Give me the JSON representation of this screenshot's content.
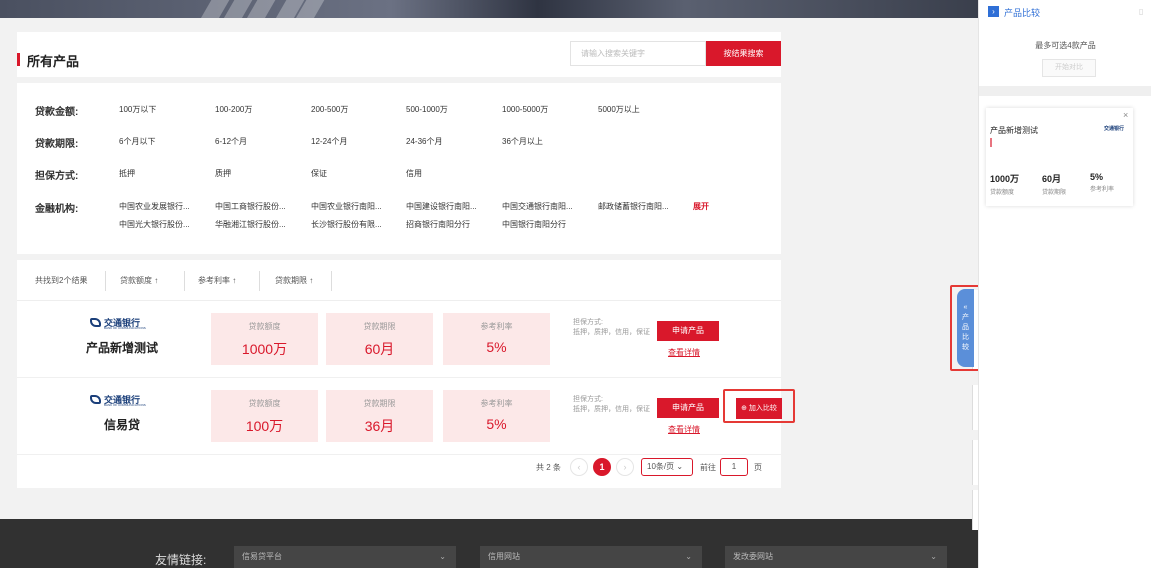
{
  "page": {
    "title": "所有产品",
    "search": {
      "placeholder": "请输入搜索关键字",
      "button": "按结果搜索"
    }
  },
  "filters": [
    {
      "label": "贷款金额:",
      "options": [
        "100万以下",
        "100-200万",
        "200-500万",
        "500-1000万",
        "1000-5000万",
        "5000万以上"
      ]
    },
    {
      "label": "贷款期限:",
      "options": [
        "6个月以下",
        "6-12个月",
        "12-24个月",
        "24-36个月",
        "36个月以上"
      ]
    },
    {
      "label": "担保方式:",
      "options": [
        "抵押",
        "质押",
        "保证",
        "信用"
      ]
    },
    {
      "label": "金融机构:",
      "options": [
        "中国农业发展银行...",
        "中国工商银行股份...",
        "中国农业银行南阳...",
        "中国建设银行南阳...",
        "中国交通银行南阳...",
        "邮政储蓄银行南阳..."
      ],
      "options2": [
        "中国光大银行股份...",
        "华融湘江银行股份...",
        "长沙银行股份有限...",
        "招商银行南阳分行",
        "中国银行南阳分行"
      ],
      "expand": "展开"
    }
  ],
  "sort": {
    "result_count": "共找到2个结果",
    "items": [
      "贷款额度 ↑",
      "参考利率 ↑",
      "贷款期限 ↑"
    ]
  },
  "products": [
    {
      "bank": "交通银行",
      "bank_en": "BANK OF COMMUNICATIONS",
      "name": "产品新增测试",
      "amount_label": "贷款额度",
      "amount": "1000万",
      "term_label": "贷款期限",
      "term": "60月",
      "rate_label": "参考利率",
      "rate": "5%",
      "guarantee_title": "担保方式:",
      "guarantee": "抵押，质押，信用，保证",
      "apply": "申请产品",
      "detail": "查看详情"
    },
    {
      "bank": "交通银行",
      "bank_en": "BANK OF COMMUNICATIONS",
      "name": "信易贷",
      "amount_label": "贷款额度",
      "amount": "100万",
      "term_label": "贷款期限",
      "term": "36月",
      "rate_label": "参考利率",
      "rate": "5%",
      "guarantee_title": "担保方式:",
      "guarantee": "抵押，质押，信用，保证",
      "apply": "申请产品",
      "detail": "查看详情",
      "compare": "⊕ 加入比较"
    }
  ],
  "pagination": {
    "total": "共 2 条",
    "prev": "‹",
    "current": "1",
    "next": "›",
    "page_size": "10条/页",
    "goto_label": "前往",
    "goto_value": "1",
    "unit": "页"
  },
  "footer": {
    "label": "友情链接:",
    "selects": [
      "信易贷平台",
      "信用网站",
      "发改委网站"
    ]
  },
  "compare_panel": {
    "title": "产品比较",
    "max_text": "最多可选4款产品",
    "start_button": "开始对比",
    "card": {
      "name": "产品新增测试",
      "logo": "交通银行",
      "stats": [
        {
          "value": "1000万",
          "label": "贷款额度"
        },
        {
          "value": "60月",
          "label": "贷款期限"
        },
        {
          "value": "5%",
          "label": "参考利率"
        }
      ]
    },
    "tab_label": "产品比较",
    "tab_arrow": "«"
  },
  "colors": {
    "accent": "#d9182b",
    "link_blue": "#2f6fd6",
    "stat_bg": "#fce8e8"
  },
  "icons": {
    "close": "close-icon",
    "chevron": "chevron-down-icon",
    "trash": "trash-icon",
    "expand_panel": "panel-toggle-icon"
  }
}
